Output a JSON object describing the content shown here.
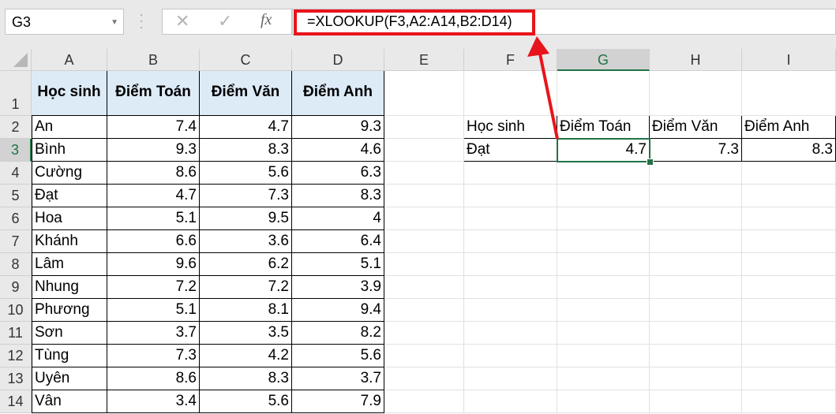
{
  "name_box": "G3",
  "formula_bar": {
    "cancel_icon": "✕",
    "enter_icon": "✓",
    "fx_label": "fx",
    "formula": "=XLOOKUP(F3,A2:A14,B2:D14)"
  },
  "columns": [
    "A",
    "B",
    "C",
    "D",
    "E",
    "F",
    "G",
    "H",
    "I"
  ],
  "rows": [
    "1",
    "2",
    "3",
    "4",
    "5",
    "6",
    "7",
    "8",
    "9",
    "10",
    "11",
    "12",
    "13",
    "14"
  ],
  "selected_cell": "G3",
  "table": {
    "headers": [
      "Học sinh",
      "Điểm Toán",
      "Điểm Văn",
      "Điểm Anh"
    ],
    "rows": [
      [
        "An",
        "7.4",
        "4.7",
        "9.3"
      ],
      [
        "Bình",
        "9.3",
        "8.3",
        "4.6"
      ],
      [
        "Cường",
        "8.6",
        "5.6",
        "6.3"
      ],
      [
        "Đạt",
        "4.7",
        "7.3",
        "8.3"
      ],
      [
        "Hoa",
        "5.1",
        "9.5",
        "4"
      ],
      [
        "Khánh",
        "6.6",
        "3.6",
        "6.4"
      ],
      [
        "Lâm",
        "9.6",
        "6.2",
        "5.1"
      ],
      [
        "Nhung",
        "7.2",
        "7.2",
        "3.9"
      ],
      [
        "Phương",
        "5.1",
        "8.1",
        "9.4"
      ],
      [
        "Sơn",
        "3.7",
        "3.5",
        "8.2"
      ],
      [
        "Tùng",
        "7.3",
        "4.2",
        "5.6"
      ],
      [
        "Uyên",
        "8.6",
        "8.3",
        "3.7"
      ],
      [
        "Vân",
        "3.4",
        "5.6",
        "7.9"
      ]
    ]
  },
  "lookup": {
    "headers": [
      "Học sinh",
      "Điểm Toán",
      "Điểm Văn",
      "Điểm Anh"
    ],
    "row": [
      "Đạt",
      "4.7",
      "7.3",
      "8.3"
    ]
  },
  "colors": {
    "accent": "#217346",
    "annotation": "#e8141b",
    "header_fill": "#ddebf7"
  }
}
